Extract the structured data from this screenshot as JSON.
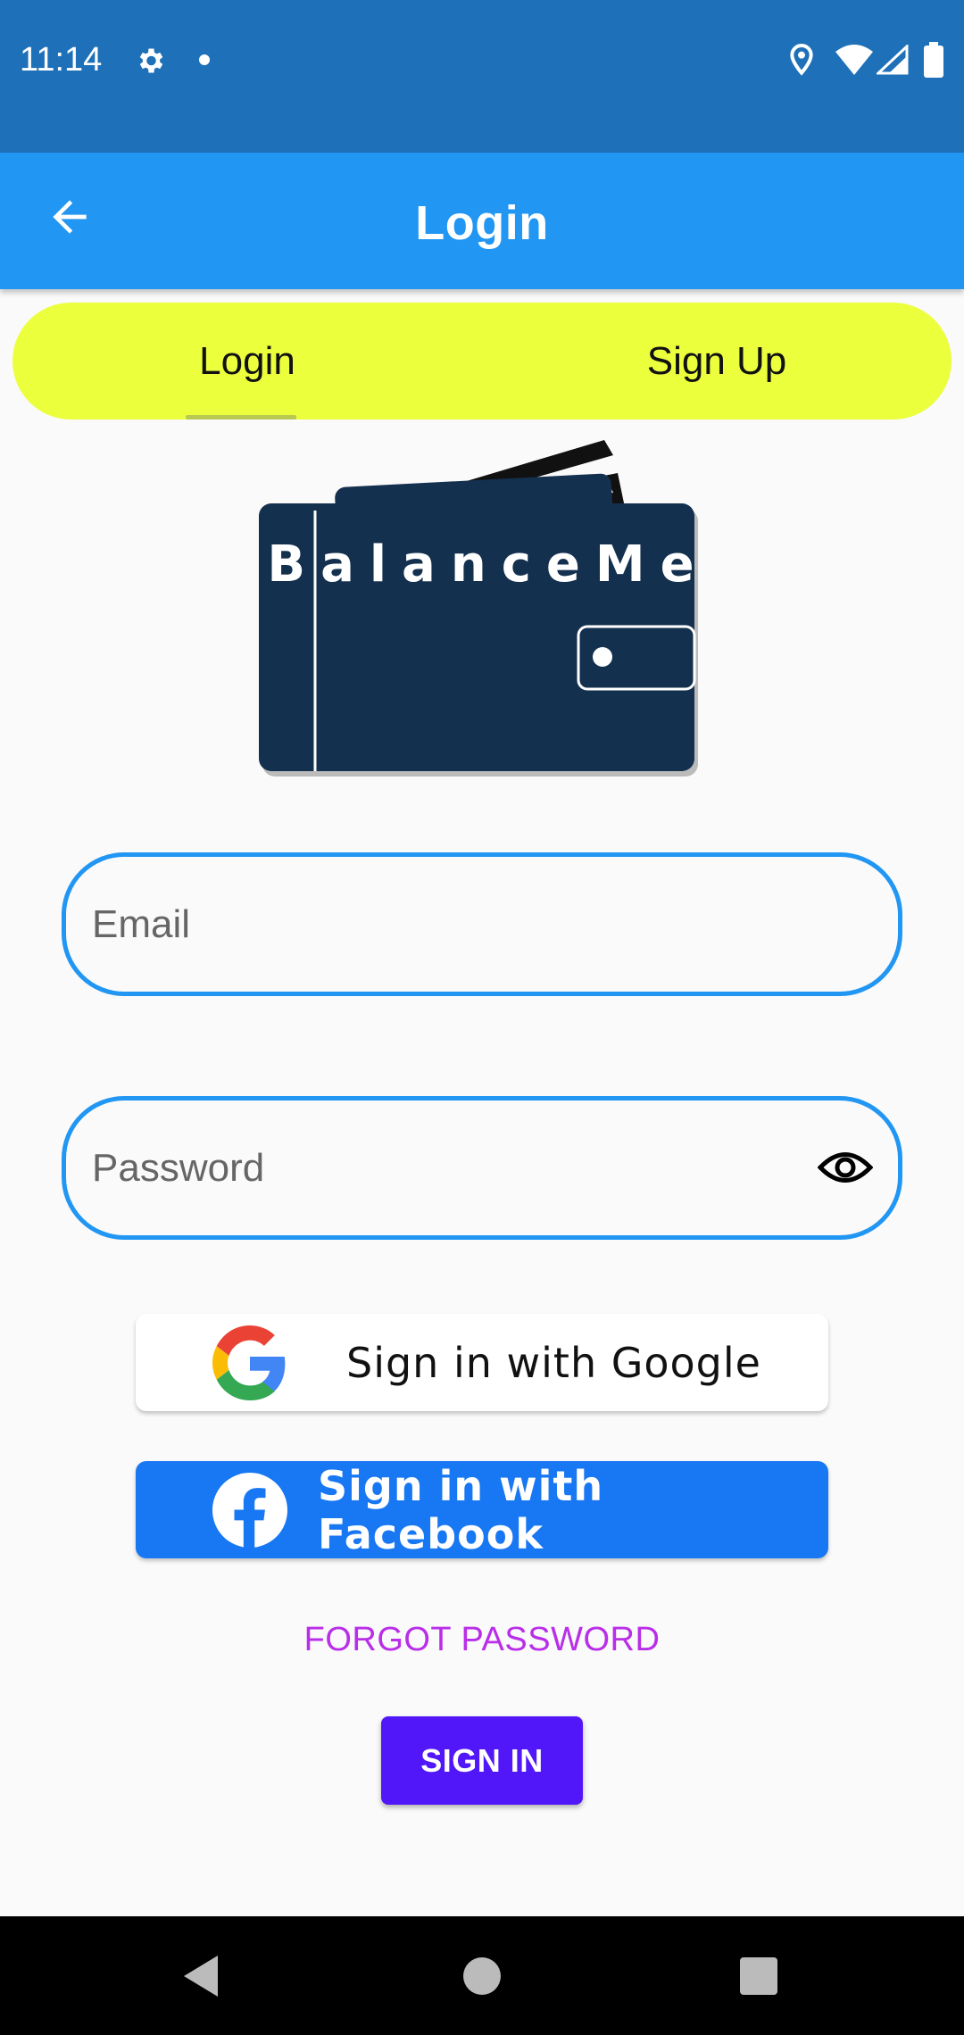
{
  "status_bar": {
    "time": "11:14",
    "icons": [
      "gear-icon",
      "notification-dot",
      "location-icon",
      "wifi-icon",
      "signal-icon",
      "battery-icon"
    ]
  },
  "app_bar": {
    "title": "Login",
    "back_icon": "arrow-left-icon"
  },
  "tabs": [
    {
      "label": "Login",
      "selected": true
    },
    {
      "label": "Sign Up",
      "selected": false
    }
  ],
  "logo": {
    "text": "BalanceMe",
    "icon": "wallet-logo"
  },
  "form": {
    "email_placeholder": "Email",
    "email_value": "",
    "password_placeholder": "Password",
    "password_value": "",
    "password_toggle_icon": "eye-icon"
  },
  "social": {
    "google_label": "Sign in with Google",
    "facebook_label": "Sign in with Facebook"
  },
  "actions": {
    "forgot_password": "FORGOT PASSWORD",
    "sign_in": "SIGN IN"
  },
  "colors": {
    "status_bar": "#1e70b8",
    "app_bar": "#2196f3",
    "tab_bar": "#ebff3d",
    "field_border": "#2196f3",
    "facebook": "#1877f2",
    "forgot_text": "#b92ee8",
    "sign_in_button": "#5117f9",
    "logo_wallet": "#14304f"
  }
}
